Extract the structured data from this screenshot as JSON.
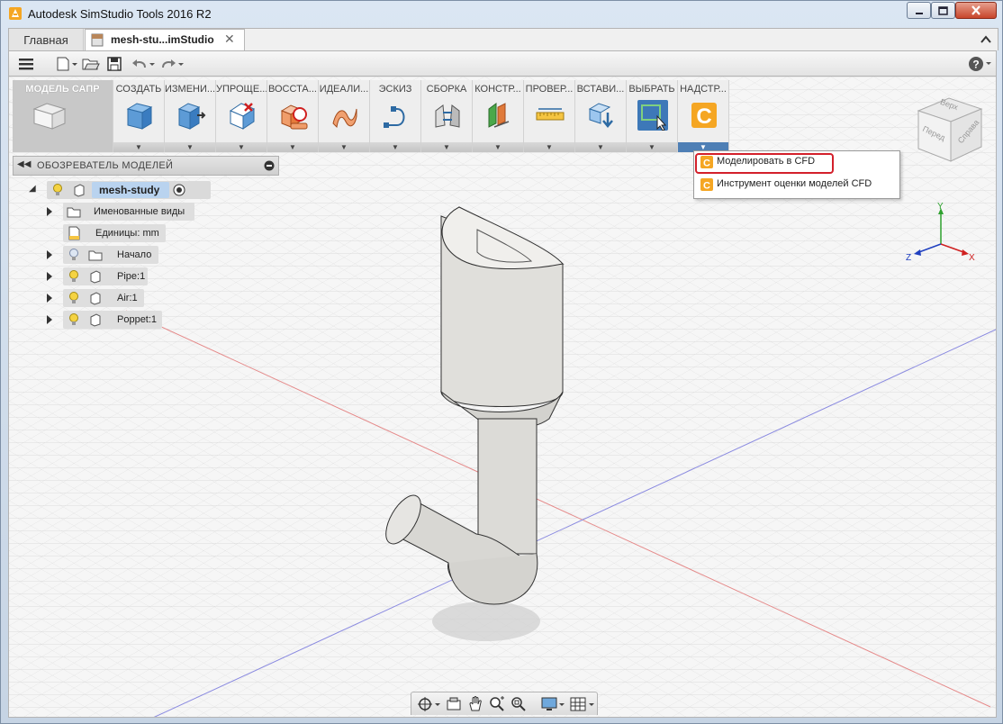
{
  "window": {
    "title": "Autodesk SimStudio Tools 2016 R2"
  },
  "tabs": {
    "home": "Главная",
    "document": "mesh-stu...imStudio"
  },
  "ribbon": {
    "groups": [
      {
        "label": "МОДЕЛЬ САПР",
        "icon": "cad-model-icon"
      },
      {
        "label": "СОЗДАТЬ",
        "icon": "create-box-icon"
      },
      {
        "label": "ИЗМЕНИ...",
        "icon": "modify-icon"
      },
      {
        "label": "УПРОЩЕ...",
        "icon": "simplify-icon"
      },
      {
        "label": "ВОССТА...",
        "icon": "restore-icon"
      },
      {
        "label": "ИДЕАЛИ...",
        "icon": "idealize-icon"
      },
      {
        "label": "ЭСКИЗ",
        "icon": "sketch-icon"
      },
      {
        "label": "СБОРКА",
        "icon": "assembly-icon"
      },
      {
        "label": "КОНСТР...",
        "icon": "construct-icon"
      },
      {
        "label": "ПРОВЕР...",
        "icon": "inspect-icon"
      },
      {
        "label": "ВСТАВИ...",
        "icon": "insert-icon"
      },
      {
        "label": "ВЫБРАТЬ",
        "icon": "select-icon"
      },
      {
        "label": "НАДСТР...",
        "icon": "addins-icon"
      }
    ]
  },
  "dropdown": {
    "items": [
      {
        "label": "Моделировать в CFD",
        "highlighted": true
      },
      {
        "label": "Инструмент оценки моделей CFD",
        "highlighted": false
      }
    ]
  },
  "browser": {
    "title": "ОБОЗРЕВАТЕЛЬ МОДЕЛЕЙ",
    "root": "mesh-study",
    "items": [
      {
        "label": "Именованные виды"
      },
      {
        "label": "Единицы: mm"
      },
      {
        "label": "Начало"
      },
      {
        "label": "Pipe:1"
      },
      {
        "label": "Air:1"
      },
      {
        "label": "Poppet:1"
      }
    ]
  },
  "viewcube": {
    "top": "Верх",
    "front": "Перед",
    "right": "Справа"
  },
  "axes": {
    "x": "X",
    "y": "Y",
    "z": "Z"
  },
  "colors": {
    "accent": "#d3202b",
    "ribbon_active": "#4e7fb5",
    "select_tool": "#3d78b8",
    "cfd_orange": "#f5a623"
  }
}
